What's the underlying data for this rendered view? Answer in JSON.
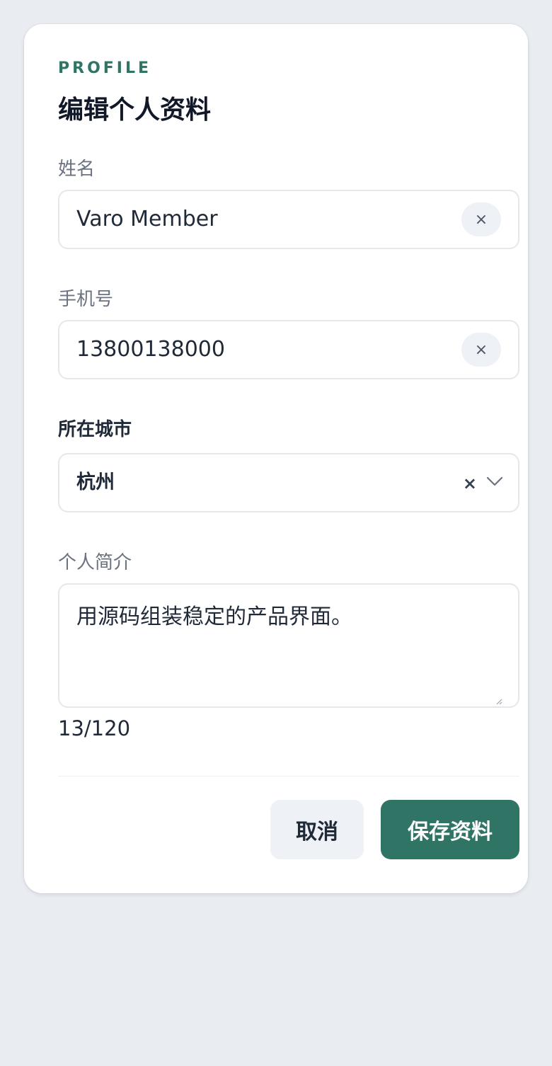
{
  "colors": {
    "accent": "#2f7465",
    "background": "#e9ecf1",
    "card": "#ffffff",
    "field_border": "#e5e7eb"
  },
  "header": {
    "eyebrow": "PROFILE",
    "title": "编辑个人资料"
  },
  "form": {
    "name": {
      "label": "姓名",
      "value": "Varo Member",
      "clear_icon": "×"
    },
    "phone": {
      "label": "手机号",
      "value": "13800138000",
      "clear_icon": "×"
    },
    "city": {
      "label": "所在城市",
      "value": "杭州",
      "clear_icon": "×",
      "dropdown_icon": "chevron-down-icon"
    },
    "bio": {
      "label": "个人简介",
      "value": "用源码组装稳定的产品界面。",
      "counter": "13/120"
    }
  },
  "actions": {
    "cancel_label": "取消",
    "save_label": "保存资料"
  }
}
